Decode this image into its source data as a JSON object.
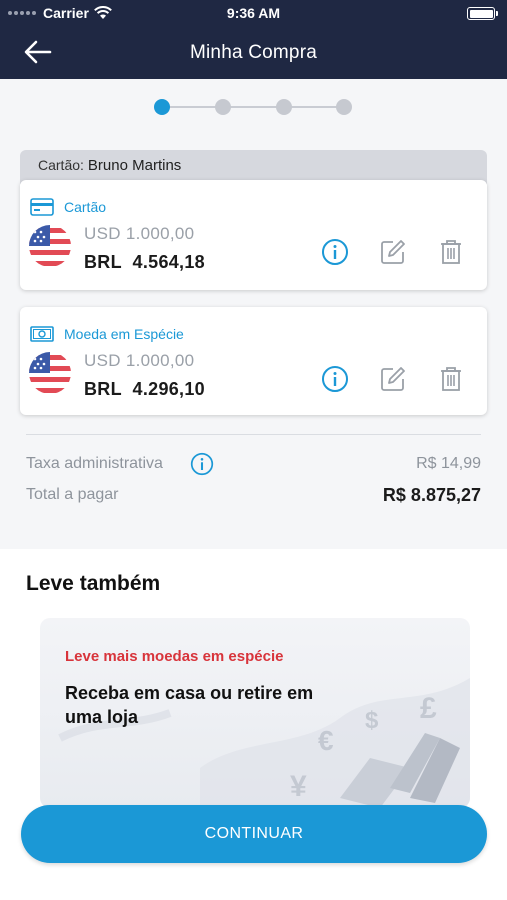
{
  "status_bar": {
    "carrier": "Carrier",
    "time": "9:36 AM"
  },
  "header": {
    "title": "Minha Compra"
  },
  "stepper": {
    "total_steps": 4,
    "current_step": 1
  },
  "holder": {
    "label": "Cartão:",
    "name": "Bruno Martins"
  },
  "items": [
    {
      "type": "Cartão",
      "icon": "card-icon",
      "usd": "USD  1.000,00",
      "brl_currency": "BRL",
      "brl_value": "4.564,18"
    },
    {
      "type": "Moeda em Espécie",
      "icon": "cash-icon",
      "usd": "USD  1.000,00",
      "brl_currency": "BRL",
      "brl_value": "4.296,10"
    }
  ],
  "summary": {
    "fee_label": "Taxa administrativa",
    "fee_value": "R$  14,99",
    "total_label": "Total a pagar",
    "total_value": "R$  8.875,27"
  },
  "upsell": {
    "heading": "Leve também",
    "promo_kicker": "Leve mais moedas em espécie",
    "promo_title": "Receba em casa ou retire em uma loja"
  },
  "cta": {
    "label": "CONTINUAR"
  },
  "colors": {
    "navy": "#1f2843",
    "accent": "#1b98d6",
    "promo_red": "#d8343b"
  }
}
